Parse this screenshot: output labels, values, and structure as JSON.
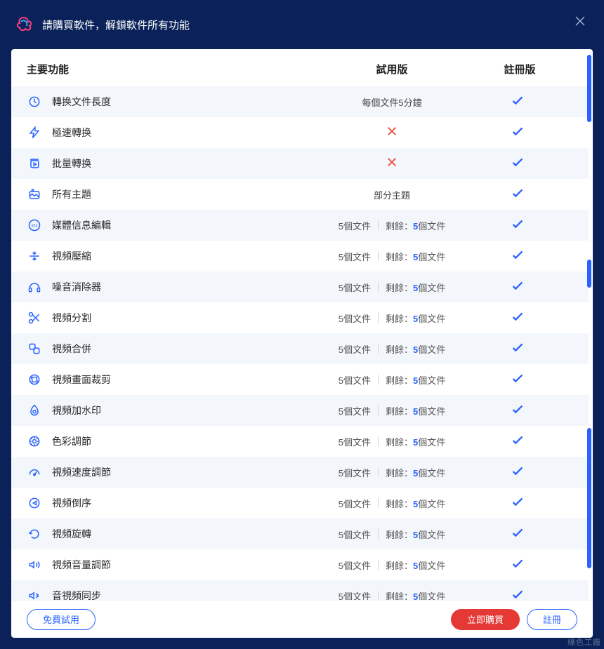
{
  "titlebar": {
    "text": "請購買軟件，解鎖軟件所有功能"
  },
  "columns": {
    "feature": "主要功能",
    "trial": "試用版",
    "registered": "註冊版"
  },
  "trial_labels": {
    "per_file_5min": "每個文件5分鐘",
    "partial_themes": "部分主題",
    "n_files": "5個文件",
    "remaining_prefix": "剩餘：",
    "remaining_count": "5",
    "remaining_suffix": "個文件"
  },
  "rows": [
    {
      "icon": "duration-icon",
      "label": "轉换文件長度",
      "trial_type": "text_5min"
    },
    {
      "icon": "fast-icon",
      "label": "極速轉换",
      "trial_type": "x"
    },
    {
      "icon": "batch-icon",
      "label": "批量轉换",
      "trial_type": "x"
    },
    {
      "icon": "theme-icon",
      "label": "所有主題",
      "trial_type": "partial"
    },
    {
      "icon": "id3-icon",
      "label": "媒體信息編輯",
      "trial_type": "split"
    },
    {
      "icon": "compress-icon",
      "label": "視頻壓縮",
      "trial_type": "split"
    },
    {
      "icon": "denoise-icon",
      "label": "噪音消除器",
      "trial_type": "split"
    },
    {
      "icon": "split-icon",
      "label": "視頻分割",
      "trial_type": "split"
    },
    {
      "icon": "merge-icon",
      "label": "視頻合併",
      "trial_type": "split"
    },
    {
      "icon": "crop-icon",
      "label": "視頻畫面裁剪",
      "trial_type": "split"
    },
    {
      "icon": "watermark-icon",
      "label": "視頻加水印",
      "trial_type": "split"
    },
    {
      "icon": "color-icon",
      "label": "色彩調節",
      "trial_type": "split"
    },
    {
      "icon": "speed-icon",
      "label": "視頻速度調節",
      "trial_type": "split"
    },
    {
      "icon": "reverse-icon",
      "label": "視頻倒序",
      "trial_type": "split"
    },
    {
      "icon": "rotate-icon",
      "label": "視頻旋轉",
      "trial_type": "split"
    },
    {
      "icon": "volume-icon",
      "label": "視頻音量調節",
      "trial_type": "split"
    },
    {
      "icon": "sync-icon",
      "label": "音視頻同步",
      "trial_type": "split"
    }
  ],
  "buttons": {
    "free_trial": "免費試用",
    "buy_now": "立即購買",
    "register": "註冊"
  },
  "watermark": "綠色工廠"
}
